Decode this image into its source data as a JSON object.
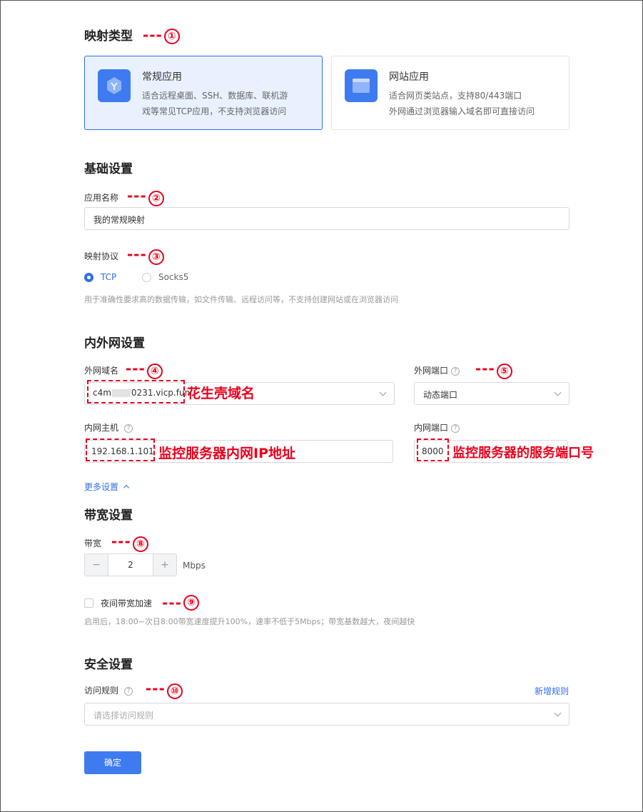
{
  "mapping_type": {
    "title": "映射类型",
    "marker": "①",
    "cards": [
      {
        "title": "常规应用",
        "desc1": "适合远程桌面、SSH、数据库、联机游",
        "desc2": "戏等常见TCP应用，不支持浏览器访问",
        "icon": "cube-icon",
        "selected": true
      },
      {
        "title": "网站应用",
        "desc1": "适合网页类站点，支持80/443端口",
        "desc2": "外网通过浏览器输入域名即可直接访问",
        "icon": "browser-icon",
        "selected": false
      }
    ]
  },
  "basic": {
    "title": "基础设置",
    "app_name_label": "应用名称",
    "app_name_marker": "②",
    "app_name_value": "我的常规映射",
    "protocol_label": "映射协议",
    "protocol_marker": "③",
    "protocol_options": [
      "TCP",
      "Socks5"
    ],
    "protocol_selected": "TCP",
    "protocol_hint": "用于准确性要求高的数据传输，如文件传输、远程访问等，不支持创建网站或在浏览器访问"
  },
  "network": {
    "title": "内外网设置",
    "ext_domain_label": "外网域名",
    "ext_domain_marker": "④",
    "ext_domain_value": "c4m",
    "ext_domain_value2": "0231.vicp.fun",
    "ext_domain_anno": "花生壳域名",
    "ext_port_label": "外网端口",
    "ext_port_marker": "⑤",
    "ext_port_value": "动态端口",
    "int_host_label": "内网主机",
    "int_host_value": "192.168.1.101",
    "int_host_anno": "监控服务器内网IP地址",
    "int_port_label": "内网端口",
    "int_port_value": "8000",
    "int_port_anno": "监控服务器的服务端口号",
    "more_settings": "更多设置"
  },
  "bandwidth": {
    "title": "带宽设置",
    "label": "带宽",
    "marker": "⑧",
    "minus": "−",
    "value": "2",
    "plus": "+",
    "unit": "Mbps",
    "night_label": "夜间带宽加速",
    "night_marker": "⑨",
    "night_hint": "启用后，18:00~次日8:00带宽速度提升100%，速率不低于5Mbps；带宽基数越大，夜间越快"
  },
  "security": {
    "title": "安全设置",
    "rule_label": "访问规则",
    "rule_marker": "⑩",
    "add_rule": "新增规则",
    "rule_placeholder": "请选择访问规则"
  },
  "submit_label": "确定",
  "dashes": "---",
  "help_glyph": "?",
  "colors": {
    "accent": "#3e7bf0",
    "annotation": "#e8001c"
  }
}
